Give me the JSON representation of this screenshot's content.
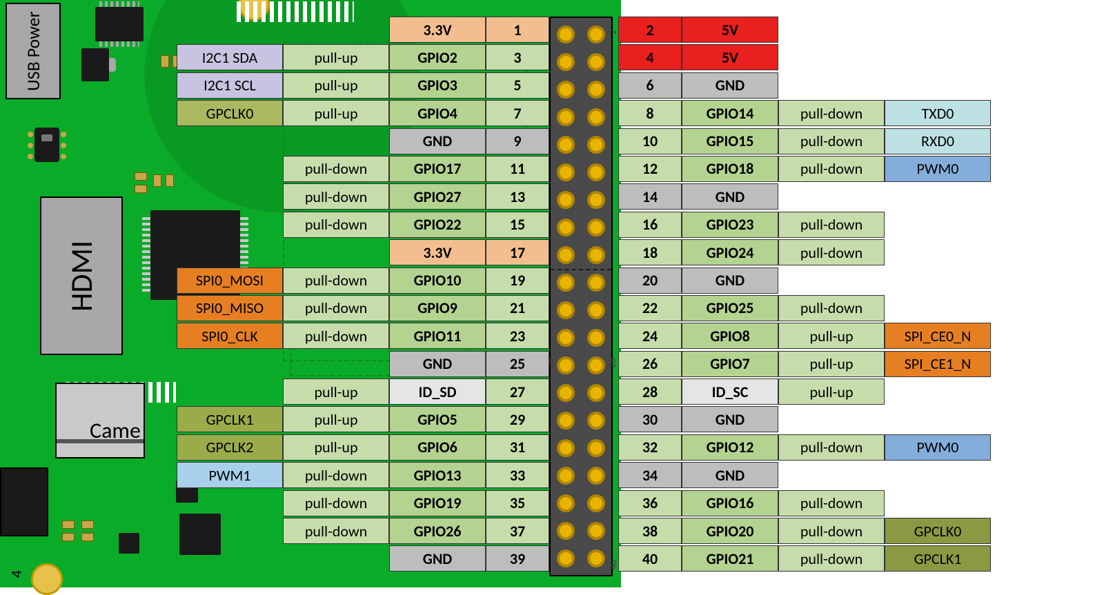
{
  "board": {
    "usb_label": "USB Power",
    "hdmi_label": "HDMI",
    "camera_label": "Came",
    "page_corner": "4"
  },
  "header": {
    "rows": 20,
    "side_nums": {
      "n2": "2",
      "n26": "26",
      "n26l": "26",
      "n40": "40"
    }
  },
  "left": [
    {
      "func": null,
      "func_cls": null,
      "pull": null,
      "name": "3.3V",
      "num": "1",
      "name_cls": "c-orange",
      "num_cls": "c-orange"
    },
    {
      "func": "I2C1 SDA",
      "func_cls": "c-purple",
      "pull": "pull-up",
      "name": "GPIO2",
      "num": "3",
      "name_cls": "c-green-b",
      "num_cls": "c-green"
    },
    {
      "func": "I2C1 SCL",
      "func_cls": "c-purple",
      "pull": "pull-up",
      "name": "GPIO3",
      "num": "5",
      "name_cls": "c-green-b",
      "num_cls": "c-green"
    },
    {
      "func": "GPCLK0",
      "func_cls": "c-olive-l",
      "pull": "pull-up",
      "name": "GPIO4",
      "num": "7",
      "name_cls": "c-green-b",
      "num_cls": "c-green"
    },
    {
      "func": null,
      "func_cls": null,
      "pull": null,
      "name": "GND",
      "num": "9",
      "name_cls": "c-gray",
      "num_cls": "c-gray"
    },
    {
      "func": null,
      "func_cls": null,
      "pull": "pull-down",
      "name": "GPIO17",
      "num": "11",
      "name_cls": "c-green-b",
      "num_cls": "c-green"
    },
    {
      "func": null,
      "func_cls": null,
      "pull": "pull-down",
      "name": "GPIO27",
      "num": "13",
      "name_cls": "c-green-b",
      "num_cls": "c-green"
    },
    {
      "func": null,
      "func_cls": null,
      "pull": "pull-down",
      "name": "GPIO22",
      "num": "15",
      "name_cls": "c-green-b",
      "num_cls": "c-green"
    },
    {
      "func": null,
      "func_cls": null,
      "pull": null,
      "name": "3.3V",
      "num": "17",
      "name_cls": "c-orange",
      "num_cls": "c-orange"
    },
    {
      "func": "SPI0_MOSI",
      "func_cls": "c-orange2",
      "pull": "pull-down",
      "name": "GPIO10",
      "num": "19",
      "name_cls": "c-green-b",
      "num_cls": "c-green"
    },
    {
      "func": "SPI0_MISO",
      "func_cls": "c-orange2",
      "pull": "pull-down",
      "name": "GPIO9",
      "num": "21",
      "name_cls": "c-green-b",
      "num_cls": "c-green"
    },
    {
      "func": "SPI0_CLK",
      "func_cls": "c-orange2",
      "pull": "pull-down",
      "name": "GPIO11",
      "num": "23",
      "name_cls": "c-green-b",
      "num_cls": "c-green"
    },
    {
      "func": null,
      "func_cls": null,
      "pull": null,
      "name": "GND",
      "num": "25",
      "name_cls": "c-gray",
      "num_cls": "c-gray"
    },
    {
      "func": null,
      "func_cls": null,
      "pull": "pull-up",
      "name": "ID_SD",
      "num": "27",
      "name_cls": "c-lgray",
      "num_cls": "c-green"
    },
    {
      "func": "GPCLK1",
      "func_cls": "c-olive2",
      "pull": "pull-up",
      "name": "GPIO5",
      "num": "29",
      "name_cls": "c-green-b",
      "num_cls": "c-green"
    },
    {
      "func": "GPCLK2",
      "func_cls": "c-olive2",
      "pull": "pull-up",
      "name": "GPIO6",
      "num": "31",
      "name_cls": "c-green-b",
      "num_cls": "c-green"
    },
    {
      "func": "PWM1",
      "func_cls": "c-blue",
      "pull": "pull-down",
      "name": "GPIO13",
      "num": "33",
      "name_cls": "c-green-b",
      "num_cls": "c-green"
    },
    {
      "func": null,
      "func_cls": null,
      "pull": "pull-down",
      "name": "GPIO19",
      "num": "35",
      "name_cls": "c-green-b",
      "num_cls": "c-green"
    },
    {
      "func": null,
      "func_cls": null,
      "pull": "pull-down",
      "name": "GPIO26",
      "num": "37",
      "name_cls": "c-green-b",
      "num_cls": "c-green"
    },
    {
      "func": null,
      "func_cls": null,
      "pull": null,
      "name": "GND",
      "num": "39",
      "name_cls": "c-gray",
      "num_cls": "c-gray"
    }
  ],
  "right": [
    {
      "num": "2",
      "name": "5V",
      "row_cls": "c-red",
      "pull": null,
      "func": null,
      "func_cls": null
    },
    {
      "num": "4",
      "name": "5V",
      "row_cls": "c-red",
      "pull": null,
      "func": null,
      "func_cls": null
    },
    {
      "num": "6",
      "name": "GND",
      "row_cls": "c-gray",
      "pull": null,
      "func": null,
      "func_cls": null
    },
    {
      "num": "8",
      "name": "GPIO14",
      "row_cls": "c-green",
      "pull": "pull-down",
      "func": "TXD0",
      "func_cls": "c-cyan"
    },
    {
      "num": "10",
      "name": "GPIO15",
      "row_cls": "c-green",
      "pull": "pull-down",
      "func": "RXD0",
      "func_cls": "c-cyan"
    },
    {
      "num": "12",
      "name": "GPIO18",
      "row_cls": "c-green",
      "pull": "pull-down",
      "func": "PWM0",
      "func_cls": "c-blue2"
    },
    {
      "num": "14",
      "name": "GND",
      "row_cls": "c-gray",
      "pull": null,
      "func": null,
      "func_cls": null
    },
    {
      "num": "16",
      "name": "GPIO23",
      "row_cls": "c-green",
      "pull": "pull-down",
      "func": null,
      "func_cls": null
    },
    {
      "num": "18",
      "name": "GPIO24",
      "row_cls": "c-green",
      "pull": "pull-down",
      "func": null,
      "func_cls": null
    },
    {
      "num": "20",
      "name": "GND",
      "row_cls": "c-gray",
      "pull": null,
      "func": null,
      "func_cls": null
    },
    {
      "num": "22",
      "name": "GPIO25",
      "row_cls": "c-green",
      "pull": "pull-down",
      "func": null,
      "func_cls": null
    },
    {
      "num": "24",
      "name": "GPIO8",
      "row_cls": "c-green",
      "pull": "pull-up",
      "func": "SPI_CE0_N",
      "func_cls": "c-orange2"
    },
    {
      "num": "26",
      "name": "GPIO7",
      "row_cls": "c-green",
      "pull": "pull-up",
      "func": "SPI_CE1_N",
      "func_cls": "c-orange2"
    },
    {
      "num": "28",
      "name": "ID_SC",
      "row_cls": "c-lgray",
      "pull": "pull-up",
      "func": null,
      "func_cls": null,
      "num_cls": "c-green",
      "pull_cls": "c-green"
    },
    {
      "num": "30",
      "name": "GND",
      "row_cls": "c-gray",
      "pull": null,
      "func": null,
      "func_cls": null
    },
    {
      "num": "32",
      "name": "GPIO12",
      "row_cls": "c-green",
      "pull": "pull-down",
      "func": "PWM0",
      "func_cls": "c-blue2"
    },
    {
      "num": "34",
      "name": "GND",
      "row_cls": "c-gray",
      "pull": null,
      "func": null,
      "func_cls": null
    },
    {
      "num": "36",
      "name": "GPIO16",
      "row_cls": "c-green",
      "pull": "pull-down",
      "func": null,
      "func_cls": null
    },
    {
      "num": "38",
      "name": "GPIO20",
      "row_cls": "c-green",
      "pull": "pull-down",
      "func": "GPCLK0",
      "func_cls": "c-olive"
    },
    {
      "num": "40",
      "name": "GPIO21",
      "row_cls": "c-green",
      "pull": "pull-down",
      "func": "GPCLK1",
      "func_cls": "c-olive"
    }
  ]
}
